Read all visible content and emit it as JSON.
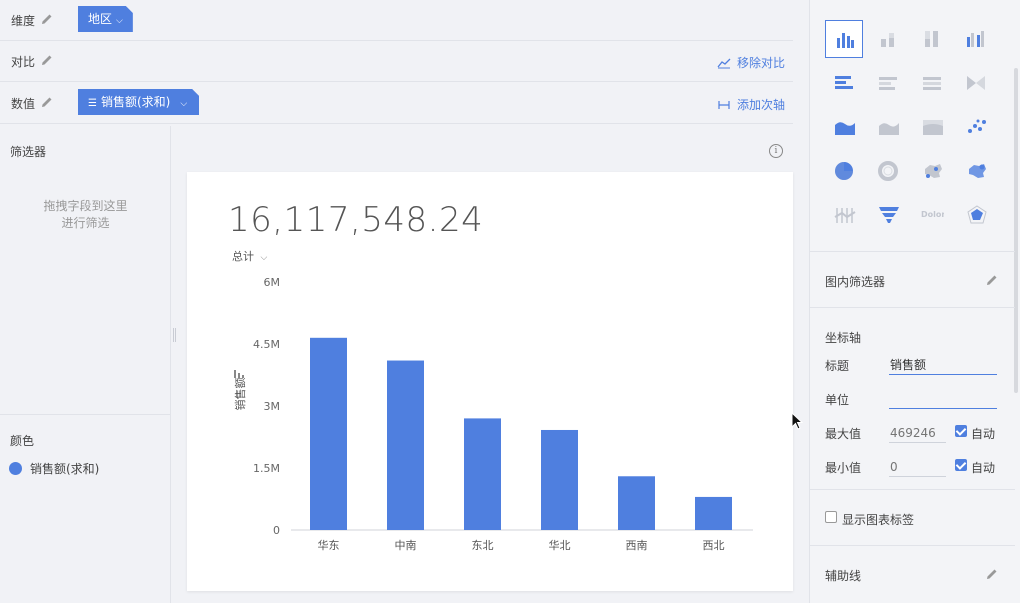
{
  "config": {
    "dimension": {
      "label": "维度",
      "pill": "地区"
    },
    "compare": {
      "label": "对比",
      "action": "移除对比"
    },
    "measure": {
      "label": "数值",
      "pill": "销售额(求和)",
      "action": "添加次轴"
    }
  },
  "filter_panel": {
    "title": "筛选器",
    "drop_hint_line1": "拖拽字段到这里",
    "drop_hint_line2": "进行筛选",
    "color_title": "颜色",
    "legend_label": "销售额(求和)"
  },
  "card": {
    "kpi_value": "16,117,548.24",
    "aggregate_label": "总计",
    "info_glyph": "i"
  },
  "chart_data": {
    "type": "bar",
    "categories": [
      "华东",
      "中南",
      "东北",
      "华北",
      "西南",
      "西北"
    ],
    "values": [
      4650000,
      4100000,
      2700000,
      2420000,
      1300000,
      800000
    ],
    "ylim": [
      0,
      6000000
    ],
    "yticks": [
      0,
      1500000,
      3000000,
      4500000,
      6000000
    ],
    "ytick_labels": [
      "0",
      "1.5M",
      "3M",
      "4.5M",
      "6M"
    ],
    "ylabel": "销售额",
    "xlabel": "",
    "grid": false,
    "color": "#4f7fdf"
  },
  "right_panel": {
    "inner_filter": "图内筛选器",
    "axis_section": "坐标轴",
    "title_label": "标题",
    "title_value": "销售额",
    "unit_label": "单位",
    "unit_value": "",
    "max_label": "最大值",
    "max_placeholder": "469246",
    "max_auto": "自动",
    "min_label": "最小值",
    "min_placeholder": "0",
    "min_auto": "自动",
    "show_labels": "显示图表标签",
    "aux_line": "辅助线",
    "dolor_word": "Dolor"
  },
  "colors": {
    "accent": "#4f7fdf",
    "chart_icon_gray": "#c2c6cf"
  }
}
